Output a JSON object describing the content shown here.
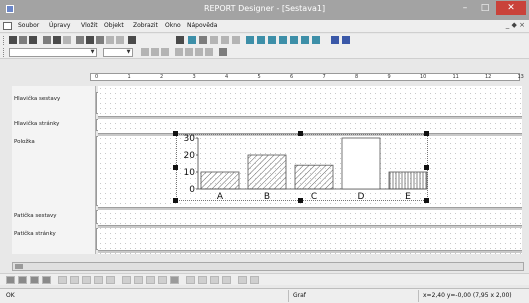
{
  "window": {
    "title": "REPORT Designer - [Sestava1]",
    "minimize_glyph": "–",
    "maximize_glyph": "□",
    "close_glyph": "✕"
  },
  "menu": {
    "items": [
      "Soubor",
      "Úpravy",
      "Vložit",
      "Objekt",
      "Zobrazit",
      "Okno",
      "Nápověda"
    ],
    "mdi_controls": "_ ◆ ×"
  },
  "ruler": {
    "marks": [
      "0",
      "1",
      "2",
      "3",
      "4",
      "5",
      "6",
      "7",
      "8",
      "9",
      "10",
      "11",
      "12",
      "13"
    ]
  },
  "sections": [
    {
      "name": "Hlavička sestavy"
    },
    {
      "name": "Hlavička stránky"
    },
    {
      "name": "Položka"
    },
    {
      "name": "Patička sestavy"
    },
    {
      "name": "Patička stránky"
    }
  ],
  "chart_data": {
    "type": "bar",
    "categories": [
      "A",
      "B",
      "C",
      "D",
      "E"
    ],
    "values": [
      10,
      20,
      14,
      30,
      10
    ],
    "y_ticks": [
      "0",
      "10",
      "20",
      "30"
    ],
    "ylim": [
      0,
      30
    ],
    "colors": {
      "bar_fill": "#d9d9d9",
      "bar_stroke": "#555555"
    }
  },
  "status": {
    "left": "OK",
    "middle": "Graf",
    "right": "x=2,40  y=-0,00  (7,95 x 2,00)"
  }
}
